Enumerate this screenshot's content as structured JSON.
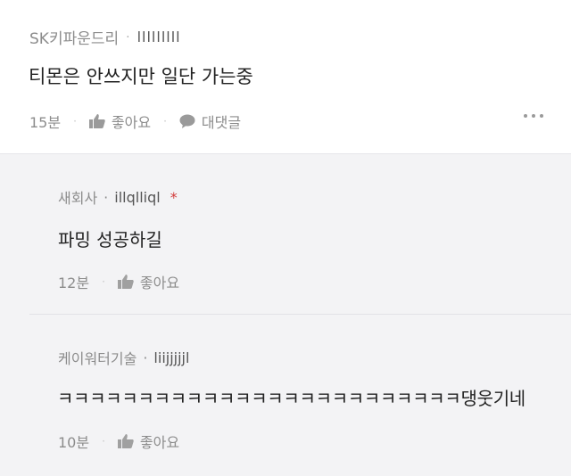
{
  "post": {
    "author": "SK키파운드리",
    "nickname": "lllllllll",
    "content": "티몬은 안쓰지만 일단 가는중",
    "time": "15분",
    "like_label": "좋아요",
    "comment_label": "대댓글"
  },
  "replies": [
    {
      "author": "새회사",
      "nickname": "illqlliql",
      "author_mark": "*",
      "content": "파밍 성공하길",
      "time": "12분",
      "like_label": "좋아요"
    },
    {
      "author": "케이워터기술",
      "nickname": "liijjjjjl",
      "content": "ㅋㅋㅋㅋㅋㅋㅋㅋㅋㅋㅋㅋㅋㅋㅋㅋㅋㅋㅋㅋㅋㅋㅋㅋㅋ댕웃기네",
      "time": "10분",
      "like_label": "좋아요"
    }
  ]
}
